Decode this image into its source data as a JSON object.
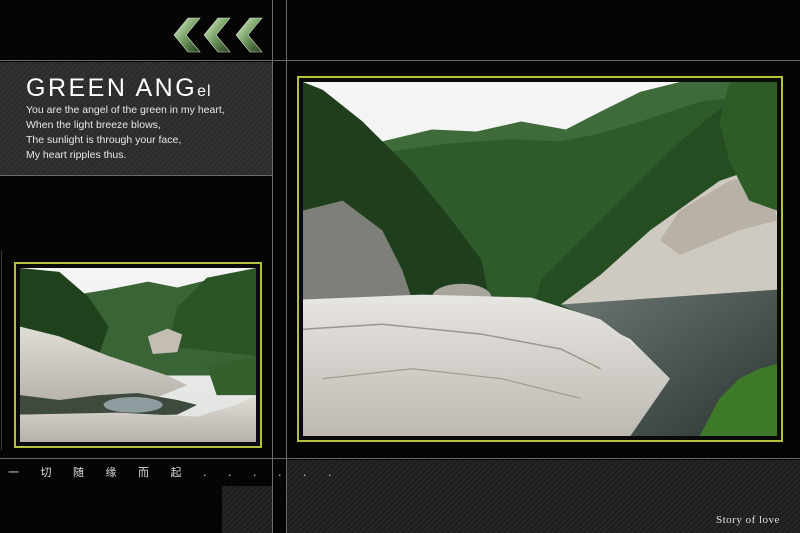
{
  "title": {
    "main": "GREEN ANG",
    "suffix": "el"
  },
  "poem": [
    "You are the angel of the green in my heart,",
    "When the light breeze blows,",
    "The sunlight is through your face,",
    "My heart ripples thus."
  ],
  "caption_cn": "一 切 随 缘 而 起 . . . . . .",
  "footer": "Story of love",
  "colors": {
    "frame": "#b5c239",
    "background": "#050505",
    "lines": "#6a6a6a"
  },
  "icons": {
    "chevrons": "triple-chevron-left-icon"
  },
  "photos": {
    "large": "mountain-river-photo",
    "small": "mountain-stream-photo"
  }
}
